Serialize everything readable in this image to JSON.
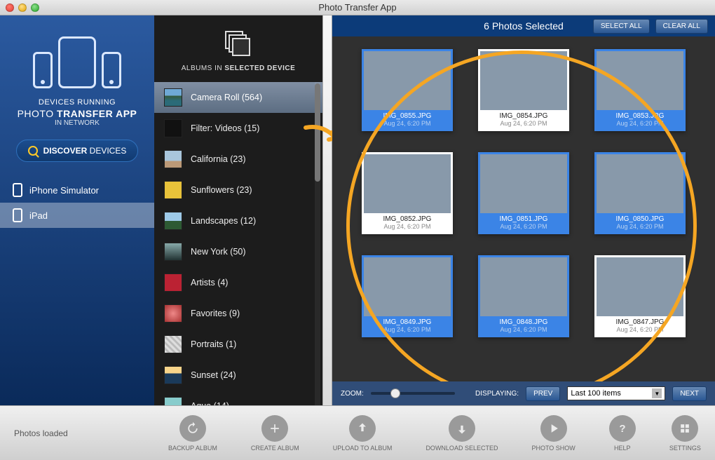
{
  "window": {
    "title": "Photo Transfer App"
  },
  "left": {
    "line1": "DEVICES RUNNING",
    "brand_a": "PHOTO",
    "brand_b": "TRANSFER APP",
    "line3": "IN NETWORK",
    "discover_a": "DISCOVER",
    "discover_b": "DEVICES",
    "devices": [
      {
        "label": "iPhone Simulator",
        "selected": false
      },
      {
        "label": "iPad",
        "selected": true
      }
    ]
  },
  "middle": {
    "header_a": "ALBUMS IN",
    "header_b": "SELECTED DEVICE",
    "albums": [
      {
        "label": "Camera Roll (564)",
        "thumb": "th-coast",
        "selected": true
      },
      {
        "label": "Filter: Videos (15)",
        "thumb": "th-video"
      },
      {
        "label": "California (23)",
        "thumb": "th-cali"
      },
      {
        "label": "Sunflowers (23)",
        "thumb": "th-sf"
      },
      {
        "label": "Landscapes (12)",
        "thumb": "th-land"
      },
      {
        "label": "New York (50)",
        "thumb": "th-ny"
      },
      {
        "label": "Artists (4)",
        "thumb": "th-art"
      },
      {
        "label": "Favorites (9)",
        "thumb": "th-fav"
      },
      {
        "label": "Portraits (1)",
        "thumb": "th-port"
      },
      {
        "label": "Sunset (24)",
        "thumb": "th-sunset"
      },
      {
        "label": "Aqua (14)",
        "thumb": "th-aqua"
      }
    ]
  },
  "right": {
    "selection_text": "6 Photos Selected",
    "select_all": "SELECT ALL",
    "clear_all": "CLEAR ALL",
    "photos": [
      {
        "name": "IMG_0855.JPG",
        "date": "Aug 24, 6:20 PM",
        "thumb": "th-coast",
        "selected": true
      },
      {
        "name": "IMG_0854.JPG",
        "date": "Aug 24, 6:20 PM",
        "thumb": "th-road",
        "selected": false
      },
      {
        "name": "IMG_0853.JPG",
        "date": "Aug 24, 6:20 PM",
        "thumb": "th-coast",
        "selected": true
      },
      {
        "name": "IMG_0852.JPG",
        "date": "Aug 24, 6:20 PM",
        "thumb": "th-flower",
        "selected": false
      },
      {
        "name": "IMG_0851.JPG",
        "date": "Aug 24, 6:20 PM",
        "thumb": "th-sun",
        "selected": true
      },
      {
        "name": "IMG_0850.JPG",
        "date": "Aug 24, 6:20 PM",
        "thumb": "th-sun",
        "selected": true
      },
      {
        "name": "IMG_0849.JPG",
        "date": "Aug 24, 6:20 PM",
        "thumb": "th-sun",
        "selected": true
      },
      {
        "name": "IMG_0848.JPG",
        "date": "Aug 24, 6:20 PM",
        "thumb": "th-flower",
        "selected": true
      },
      {
        "name": "IMG_0847.JPG",
        "date": "Aug 24, 6:20 PM",
        "thumb": "th-sun",
        "selected": false
      }
    ],
    "zoom_label": "ZOOM:",
    "displaying_label": "DISPLAYING:",
    "prev": "PREV",
    "next": "NEXT",
    "display_value": "Last 100 items"
  },
  "bottom": {
    "status": "Photos loaded",
    "tools": [
      {
        "label": "BACKUP ALBUM",
        "icon": "backup"
      },
      {
        "label": "CREATE ALBUM",
        "icon": "plus"
      },
      {
        "label": "UPLOAD TO ALBUM",
        "icon": "upload"
      },
      {
        "label": "DOWNLOAD SELECTED",
        "icon": "download"
      },
      {
        "label": "PHOTO SHOW",
        "icon": "play"
      },
      {
        "label": "HELP",
        "icon": "help"
      },
      {
        "label": "SETTINGS",
        "icon": "settings"
      }
    ]
  }
}
